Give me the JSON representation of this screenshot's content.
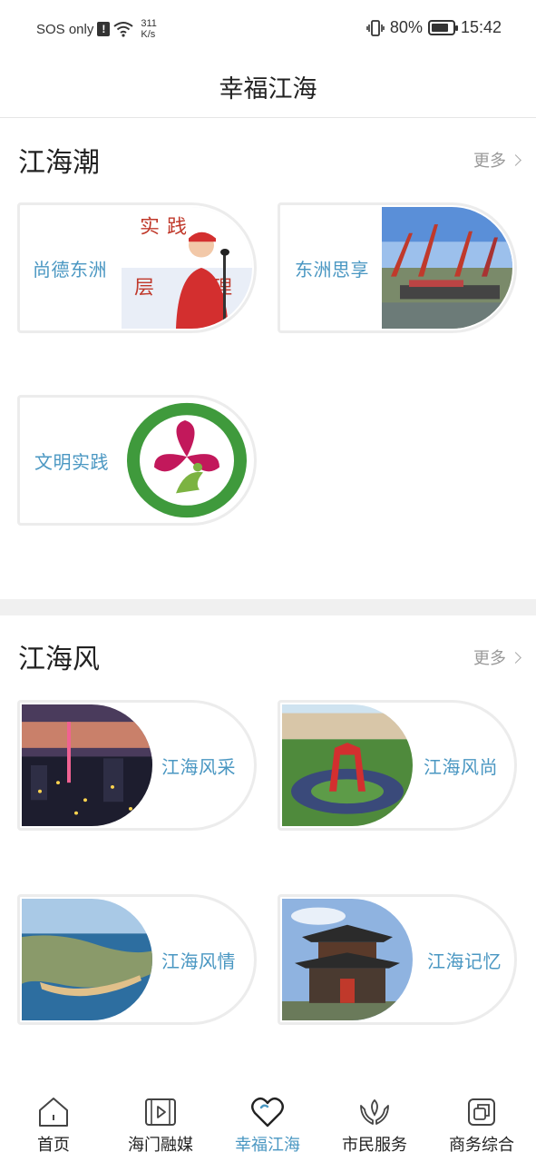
{
  "status_bar": {
    "carrier": "SOS only",
    "alert_glyph": "!",
    "net_speed_value": "311",
    "net_speed_unit": "K/s",
    "battery": "80%",
    "battery_level": 0.8,
    "time": "15:42"
  },
  "header": {
    "title": "幸福江海"
  },
  "sections": [
    {
      "title": "江海潮",
      "more": "更多",
      "cards": [
        {
          "label": "尚德东洲",
          "icon": "volunteer-speaker-photo"
        },
        {
          "label": "东洲思享",
          "icon": "shipyard-cranes-photo"
        },
        {
          "label": "文明实践",
          "icon": "civilization-practice-logo"
        }
      ]
    },
    {
      "title": "江海风",
      "more": "更多",
      "cards": [
        {
          "label": "江海风采",
          "icon": "city-night-skyline-photo"
        },
        {
          "label": "江海风尚",
          "icon": "red-arch-roundabout-photo"
        },
        {
          "label": "江海风情",
          "icon": "coastal-island-aerial-photo"
        },
        {
          "label": "江海记忆",
          "icon": "traditional-pavilion-photo"
        }
      ]
    }
  ],
  "bottom_nav": {
    "active_color": "#4a97c2",
    "items": [
      {
        "label": "首页",
        "icon": "home-icon"
      },
      {
        "label": "海门融媒",
        "icon": "video-play-icon"
      },
      {
        "label": "幸福江海",
        "icon": "heart-icon",
        "active": true
      },
      {
        "label": "市民服务",
        "icon": "hands-leaf-icon"
      },
      {
        "label": "商务综合",
        "icon": "business-layers-icon"
      }
    ]
  }
}
